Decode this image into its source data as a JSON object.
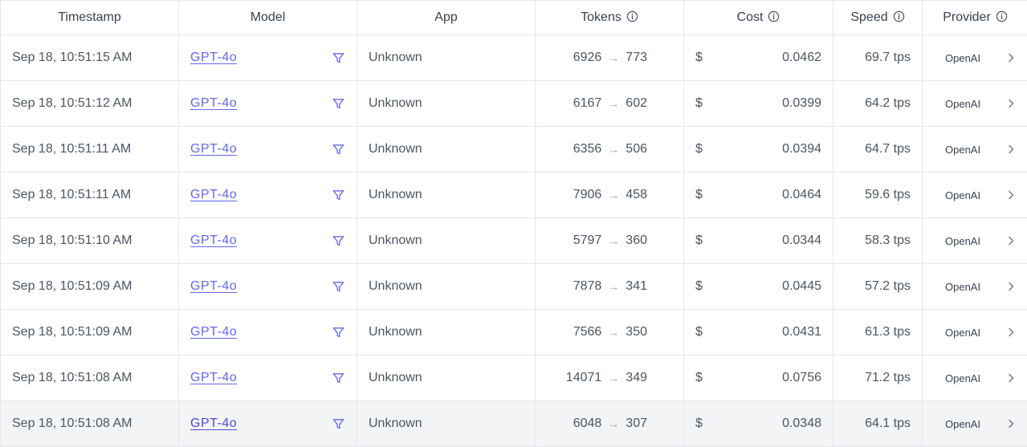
{
  "columns": {
    "timestamp": "Timestamp",
    "model": "Model",
    "app": "App",
    "tokens": "Tokens",
    "cost": "Cost",
    "speed": "Speed",
    "provider": "Provider"
  },
  "currency_symbol": "$",
  "arrow": "→",
  "rows": [
    {
      "timestamp": "Sep 18, 10:51:15 AM",
      "model": "GPT-4o",
      "app": "Unknown",
      "tokens_in": "6926",
      "tokens_out": "773",
      "cost": "0.0462",
      "speed": "69.7 tps",
      "provider": "OpenAI"
    },
    {
      "timestamp": "Sep 18, 10:51:12 AM",
      "model": "GPT-4o",
      "app": "Unknown",
      "tokens_in": "6167",
      "tokens_out": "602",
      "cost": "0.0399",
      "speed": "64.2 tps",
      "provider": "OpenAI"
    },
    {
      "timestamp": "Sep 18, 10:51:11 AM",
      "model": "GPT-4o",
      "app": "Unknown",
      "tokens_in": "6356",
      "tokens_out": "506",
      "cost": "0.0394",
      "speed": "64.7 tps",
      "provider": "OpenAI"
    },
    {
      "timestamp": "Sep 18, 10:51:11 AM",
      "model": "GPT-4o",
      "app": "Unknown",
      "tokens_in": "7906",
      "tokens_out": "458",
      "cost": "0.0464",
      "speed": "59.6 tps",
      "provider": "OpenAI"
    },
    {
      "timestamp": "Sep 18, 10:51:10 AM",
      "model": "GPT-4o",
      "app": "Unknown",
      "tokens_in": "5797",
      "tokens_out": "360",
      "cost": "0.0344",
      "speed": "58.3 tps",
      "provider": "OpenAI"
    },
    {
      "timestamp": "Sep 18, 10:51:09 AM",
      "model": "GPT-4o",
      "app": "Unknown",
      "tokens_in": "7878",
      "tokens_out": "341",
      "cost": "0.0445",
      "speed": "57.2 tps",
      "provider": "OpenAI"
    },
    {
      "timestamp": "Sep 18, 10:51:09 AM",
      "model": "GPT-4o",
      "app": "Unknown",
      "tokens_in": "7566",
      "tokens_out": "350",
      "cost": "0.0431",
      "speed": "61.3 tps",
      "provider": "OpenAI"
    },
    {
      "timestamp": "Sep 18, 10:51:08 AM",
      "model": "GPT-4o",
      "app": "Unknown",
      "tokens_in": "14071",
      "tokens_out": "349",
      "cost": "0.0756",
      "speed": "71.2 tps",
      "provider": "OpenAI"
    },
    {
      "timestamp": "Sep 18, 10:51:08 AM",
      "model": "GPT-4o",
      "app": "Unknown",
      "tokens_in": "6048",
      "tokens_out": "307",
      "cost": "0.0348",
      "speed": "64.1 tps",
      "provider": "OpenAI"
    }
  ],
  "colors": {
    "link": "#6366f1",
    "border": "#e5e7eb",
    "hover_row": "#f3f4f6"
  },
  "icons": {
    "header_info": "info-icon",
    "model_filter": "filter-icon",
    "row_expand": "chevron-right-icon"
  }
}
